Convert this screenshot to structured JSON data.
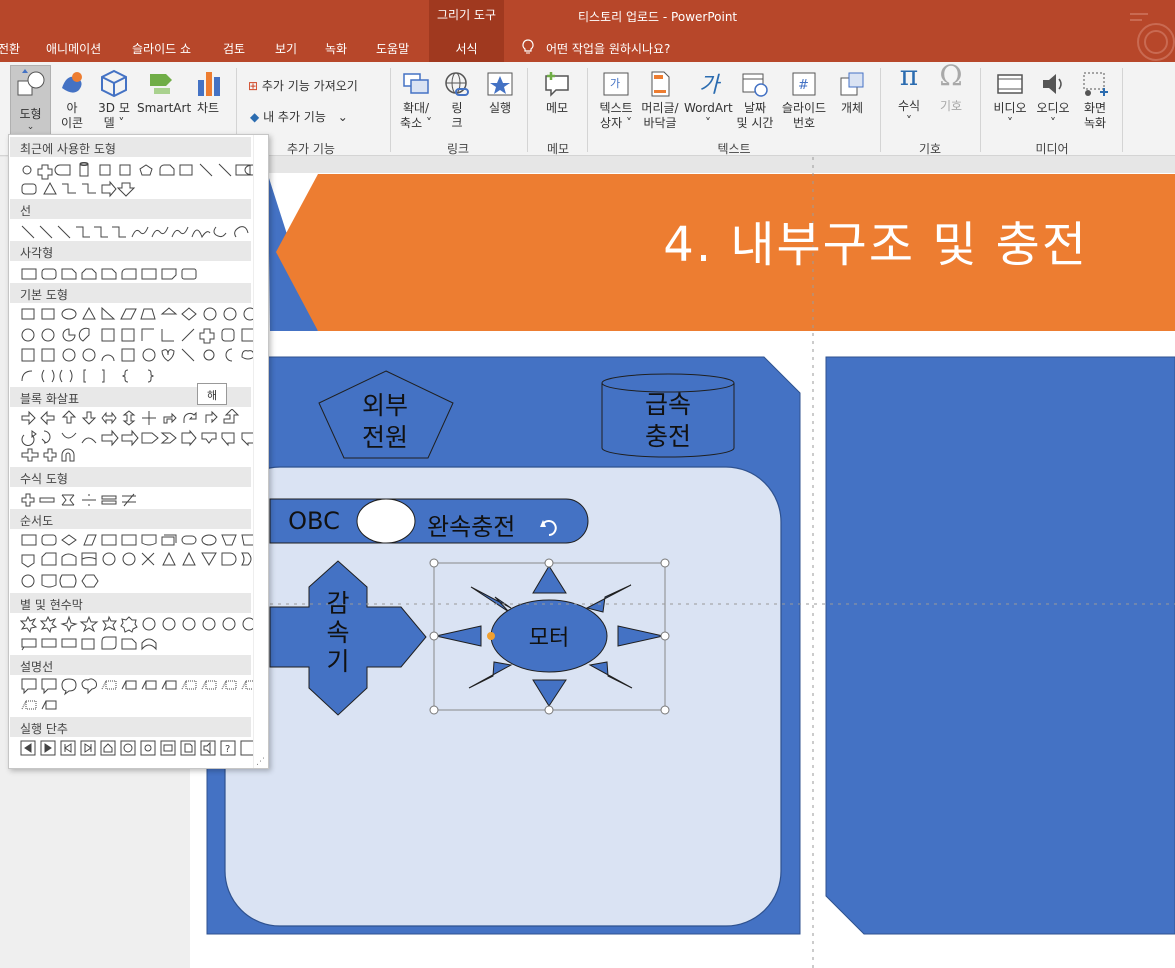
{
  "window": {
    "title": "티스토리 업로드  -  PowerPoint",
    "context_group": "그리기 도구",
    "tabs": [
      "전환",
      "애니메이션",
      "슬라이드 쇼",
      "검토",
      "보기",
      "녹화",
      "도움말"
    ],
    "active_tab": "서식",
    "tell_me": "어떤 작업을 원하시나요?"
  },
  "ribbon": {
    "illustrations": {
      "shapes": "도형",
      "icons": "아\n이콘",
      "models": "3D 모\n델 ˅",
      "smartart": "SmartArt",
      "chart": "차트"
    },
    "addins": {
      "get": "추가 기능 가져오기",
      "mine": "내 추가 기능",
      "label": "추가 기능"
    },
    "links": {
      "zoom": "확대/\n축소 ˅",
      "link": "링\n크",
      "action": "실행",
      "label": "링크"
    },
    "comments": {
      "comment": "메모",
      "label": "메모"
    },
    "text": {
      "textbox": "텍스트\n상자 ˅",
      "header": "머리글/\n바닥글",
      "wordart": "WordArt\n˅",
      "datetime": "날짜\n및 시간",
      "slidenum": "슬라이드\n번호",
      "object": "개체",
      "label": "텍스트"
    },
    "symbols": {
      "equation": "수식\n˅",
      "symbol": "기호",
      "label": "기호"
    },
    "media": {
      "video": "비디오\n˅",
      "audio": "오디오\n˅",
      "screenrec": "화면\n녹화",
      "label": "미디어"
    }
  },
  "gallery": {
    "sections": [
      "최근에 사용한 도형",
      "선",
      "사각형",
      "기본 도형",
      "블록 화살표",
      "수식 도형",
      "순서도",
      "별 및 현수막",
      "설명선",
      "실행 단추"
    ],
    "tooltip": "해"
  },
  "slide": {
    "title": "4. 내부구조 및 충전",
    "shapes": {
      "external_power": "외부\n전원",
      "fast_charge": "급속\n충전",
      "obc": "OBC",
      "slow_charge": "완속충전",
      "reducer": "감\n속\n기",
      "motor": "모터"
    }
  },
  "colors": {
    "title_bar": "#b7472a",
    "orange_banner": "#ed7d31",
    "blue_shape": "#4472c4",
    "light_blue": "#dae3f3"
  }
}
